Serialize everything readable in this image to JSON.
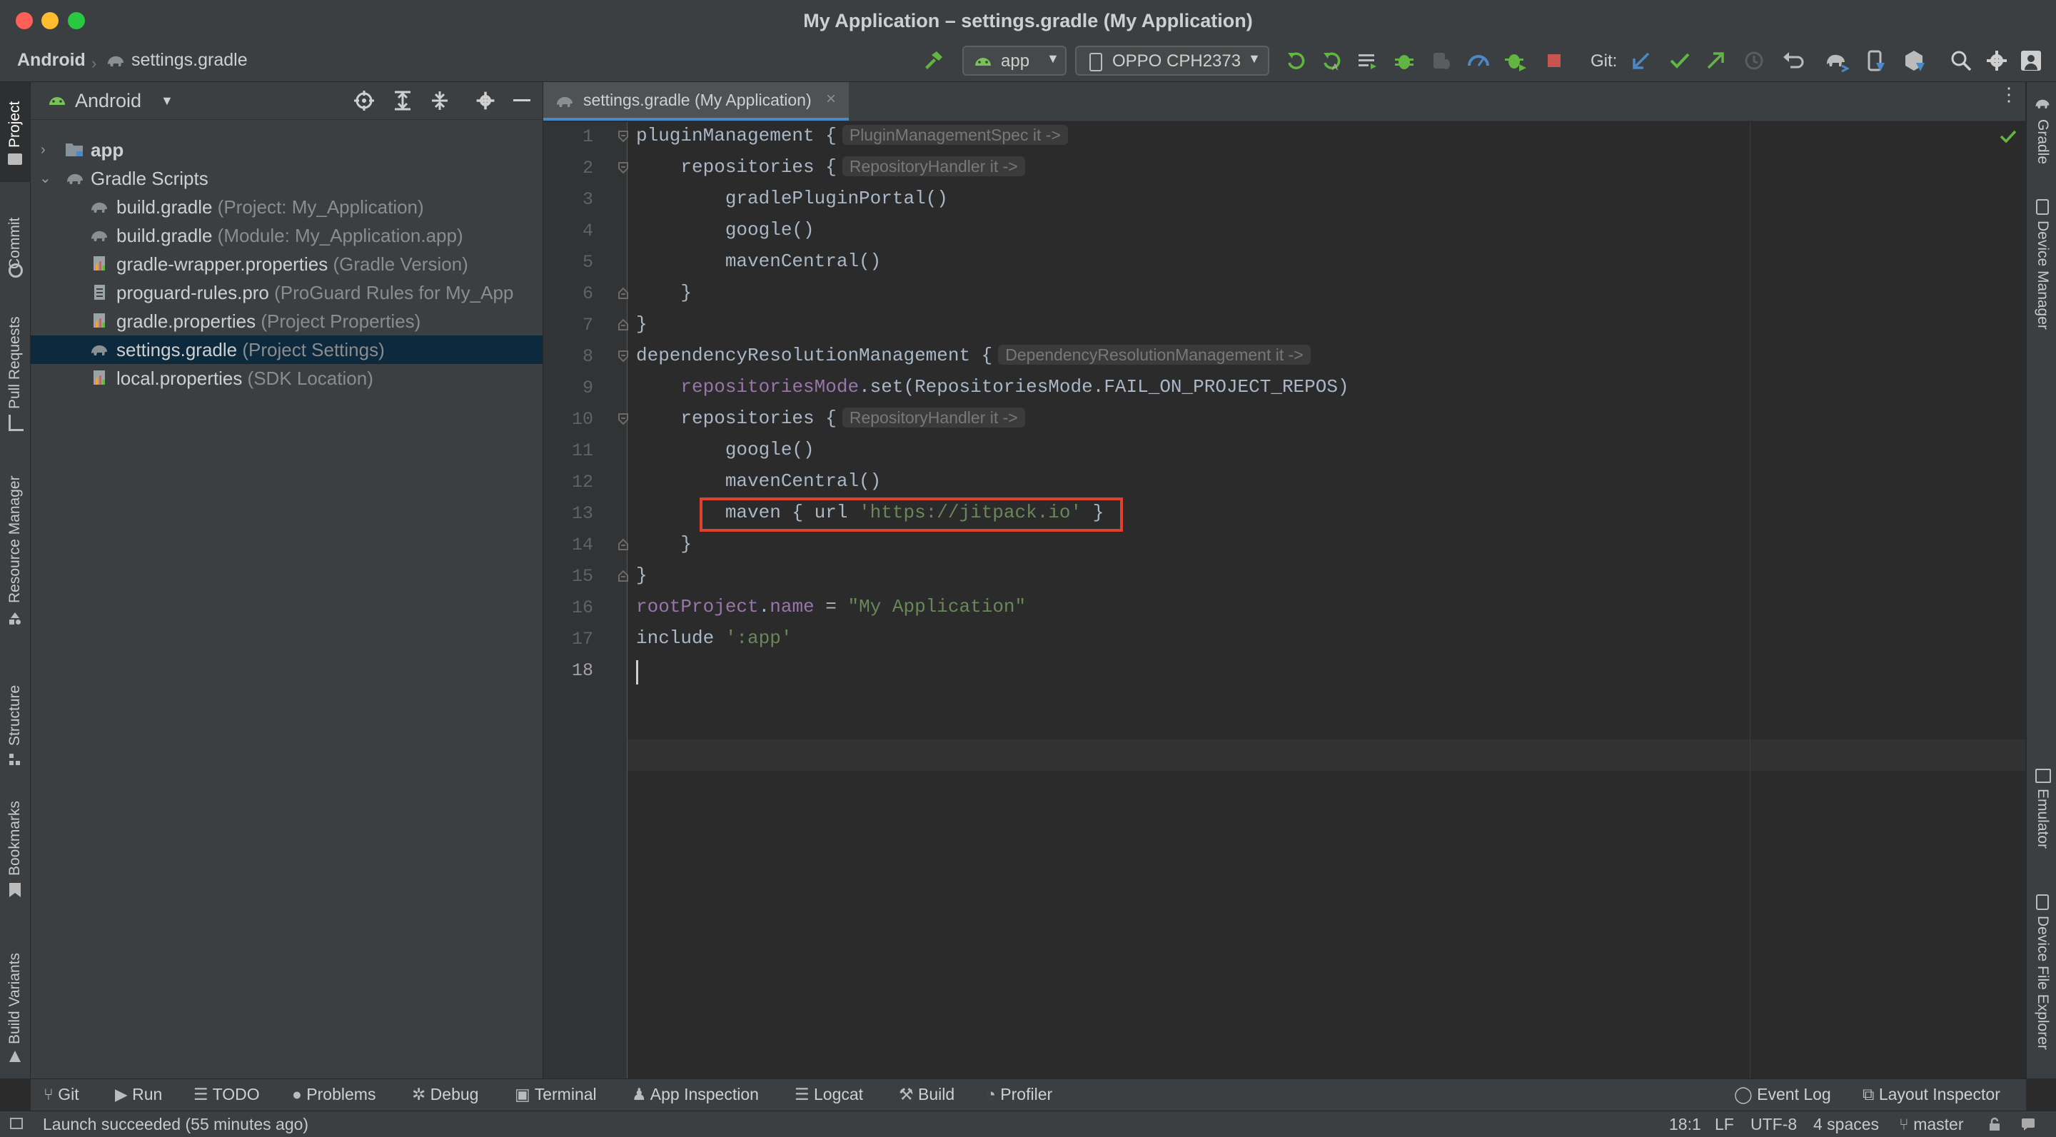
{
  "window": {
    "title": "My Application – settings.gradle (My Application)"
  },
  "navbar": {
    "crumb_root": "Android",
    "crumb_file": "settings.gradle",
    "run_config": "app",
    "device": "OPPO CPH2373",
    "git_label": "Git:"
  },
  "left_tools": [
    "Project",
    "Commit",
    "Pull Requests",
    "Resource Manager",
    "Structure",
    "Bookmarks",
    "Build Variants"
  ],
  "right_tools": [
    "Gradle",
    "Device Manager",
    "Emulator",
    "Device File Explorer"
  ],
  "project_panel": {
    "view_mode": "Android",
    "items": [
      {
        "name": "app",
        "hint": "",
        "icon": "folder-icon"
      },
      {
        "name": "Gradle Scripts",
        "hint": "",
        "icon": "gradle-icon"
      },
      {
        "name": "build.gradle",
        "hint": "(Project: My_Application)",
        "icon": "gradle-icon"
      },
      {
        "name": "build.gradle",
        "hint": "(Module: My_Application.app)",
        "icon": "gradle-icon"
      },
      {
        "name": "gradle-wrapper.properties",
        "hint": "(Gradle Version)",
        "icon": "properties-icon"
      },
      {
        "name": "proguard-rules.pro",
        "hint": "(ProGuard Rules for My_App",
        "icon": "file-icon"
      },
      {
        "name": "gradle.properties",
        "hint": "(Project Properties)",
        "icon": "properties-icon"
      },
      {
        "name": "settings.gradle",
        "hint": "(Project Settings)",
        "icon": "gradle-icon"
      },
      {
        "name": "local.properties",
        "hint": "(SDK Location)",
        "icon": "properties-icon"
      }
    ]
  },
  "editor": {
    "tab_label": "settings.gradle (My Application)",
    "code": {
      "l1": "pluginManagement {",
      "l1_hint": "PluginManagementSpec it ->",
      "l2": "    repositories {",
      "l2_hint": "RepositoryHandler it ->",
      "l3": "        gradlePluginPortal()",
      "l4": "        google()",
      "l5": "        mavenCentral()",
      "l6": "    }",
      "l7": "}",
      "l8": "dependencyResolutionManagement {",
      "l8_hint": "DependencyResolutionManagement it ->",
      "l9_a": "    ",
      "l9_b": "repositoriesMode",
      "l9_c": ".set(RepositoriesMode.FAIL_ON_PROJECT_REPOS)",
      "l10": "    repositories {",
      "l10_hint": "RepositoryHandler it ->",
      "l11": "        google()",
      "l12": "        mavenCentral()",
      "l13_a": "        maven { url ",
      "l13_b": "'https://jitpack.io'",
      "l13_c": " }",
      "l14": "    }",
      "l15": "}",
      "l16_a": "rootProject",
      "l16_b": ".",
      "l16_c": "name",
      "l16_d": " = ",
      "l16_e": "\"My Application\"",
      "l17_a": "include ",
      "l17_b": "':app'"
    },
    "line_numbers": [
      "1",
      "2",
      "3",
      "4",
      "5",
      "6",
      "7",
      "8",
      "9",
      "10",
      "11",
      "12",
      "13",
      "14",
      "15",
      "16",
      "17",
      "18"
    ]
  },
  "bottom_tools": [
    "Git",
    "Run",
    "TODO",
    "Problems",
    "Debug",
    "Terminal",
    "App Inspection",
    "Logcat",
    "Build",
    "Profiler"
  ],
  "bottom_right_tools": [
    "Event Log",
    "Layout Inspector"
  ],
  "status": {
    "message": "Launch succeeded (55 minutes ago)",
    "position": "18:1",
    "line_sep": "LF",
    "encoding": "UTF-8",
    "indent": "4 spaces",
    "branch": "master"
  },
  "colors": {
    "highlight_box": "#e0402e",
    "selection": "#0d293e",
    "accent": "#4a88c7"
  }
}
